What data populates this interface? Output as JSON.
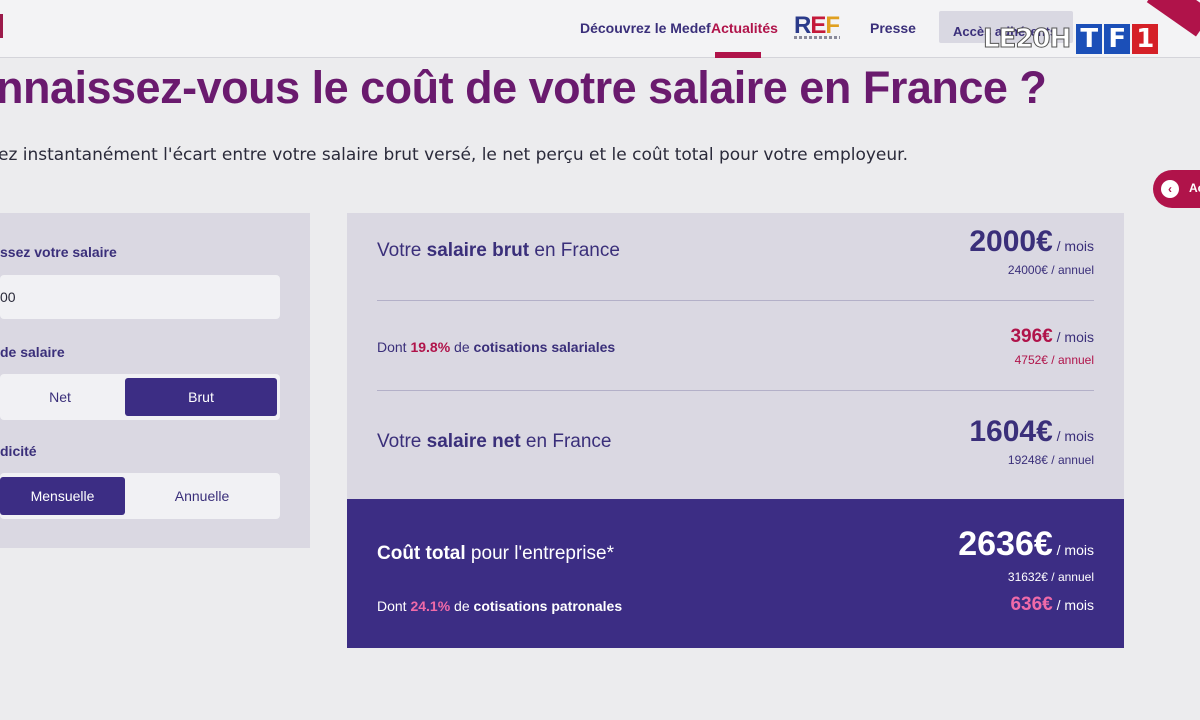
{
  "header": {
    "nav": [
      "Découvrez le Medef",
      "Actualités",
      "Presse"
    ],
    "active_nav": "Actualités",
    "logo_text": "REF",
    "member_button": "Accès adhérents"
  },
  "tv_overlay": {
    "show": "LE20H",
    "channel": [
      "T",
      "F",
      "1"
    ]
  },
  "page": {
    "title": "nnaissez-vous le coût de votre salaire en France ?",
    "subtitle": "ez instantanément l'écart entre votre salaire brut versé, le net perçu et le coût total pour votre employeur."
  },
  "side_tab": {
    "label": "Ac"
  },
  "form": {
    "salary_label": "ssez votre salaire",
    "salary_value": "00",
    "type_label": "de salaire",
    "type_options": [
      "Net",
      "Brut"
    ],
    "type_selected": "Brut",
    "period_label": "dicité",
    "period_options": [
      "Mensuelle",
      "Annuelle"
    ],
    "period_selected": "Mensuelle"
  },
  "results": {
    "brut": {
      "prefix": "Votre ",
      "strong": "salaire brut",
      "suffix": " en France",
      "monthly": "2000€",
      "per_month": " / mois",
      "annual": "24000€ / annuel"
    },
    "cotisations_salariales": {
      "prefix": "Dont ",
      "pct": "19.8%",
      "middle": " de ",
      "strong": "cotisations salariales",
      "monthly": "396€",
      "per_month": " / mois",
      "annual": "4752€ / annuel"
    },
    "net": {
      "prefix": "Votre ",
      "strong": "salaire net",
      "suffix": " en France",
      "monthly": "1604€",
      "per_month": " / mois",
      "annual": "19248€ / annuel"
    },
    "total": {
      "strong": "Coût total",
      "suffix": " pour l'entreprise*",
      "monthly": "2636€",
      "per_month": " / mois",
      "annual": "31632€ / annuel"
    },
    "cotisations_patronales": {
      "prefix": "Dont ",
      "pct": "24.1%",
      "middle": " de ",
      "strong": "cotisations patronales",
      "monthly": "636€",
      "per_month": " / mois"
    }
  },
  "colors": {
    "accent": "#b0134a",
    "primary": "#3c2d84",
    "title": "#6a1a6e",
    "panel": "#dad8e2"
  }
}
